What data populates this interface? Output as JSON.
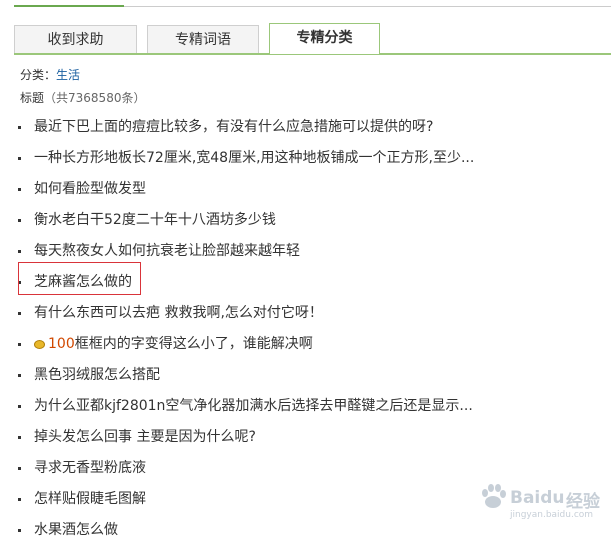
{
  "tabs": [
    {
      "label": "收到求助"
    },
    {
      "label": "专精词语"
    },
    {
      "label": "专精分类"
    }
  ],
  "category": {
    "label": "分类：",
    "value": "生活"
  },
  "title_info": {
    "label": "标题",
    "count": "（共7368580条）"
  },
  "questions": [
    {
      "text": "最近下巴上面的痘痘比较多，有没有什么应急措施可以提供的呀?"
    },
    {
      "text": "一种长方形地板长72厘米,宽48厘米,用这种地板铺成一个正方形,至少..."
    },
    {
      "text": "如何看脸型做发型"
    },
    {
      "text": "衡水老白干52度二十年十八酒坊多少钱"
    },
    {
      "text": "每天熬夜女人如何抗衰老让脸部越来越年轻"
    },
    {
      "text": "芝麻酱怎么做的"
    },
    {
      "text": "有什么东西可以去疤 救救我啊,怎么对付它呀！"
    },
    {
      "reward": "100",
      "text": "框框内的字变得这么小了，谁能解决啊"
    },
    {
      "text": "黑色羽绒服怎么搭配"
    },
    {
      "text": "为什么亚都kjf2801n空气净化器加满水后选择去甲醛键之后还是显示..."
    },
    {
      "text": "掉头发怎么回事 主要是因为什么呢?"
    },
    {
      "text": "寻求无香型粉底液"
    },
    {
      "text": "怎样贴假睫毛图解"
    },
    {
      "text": "水果酒怎么做"
    }
  ],
  "icons": {
    "reward_coin": "coin-icon",
    "bullet": "bullet-dot"
  },
  "colors": {
    "accent_green": "#9bc77a",
    "link_blue": "#1a5fa0",
    "reward_orange": "#d14800",
    "highlight_red": "#d9343a"
  },
  "watermark": {
    "brand": "Baidu",
    "cn": "经验",
    "url": "jingyan.baidu.com"
  }
}
